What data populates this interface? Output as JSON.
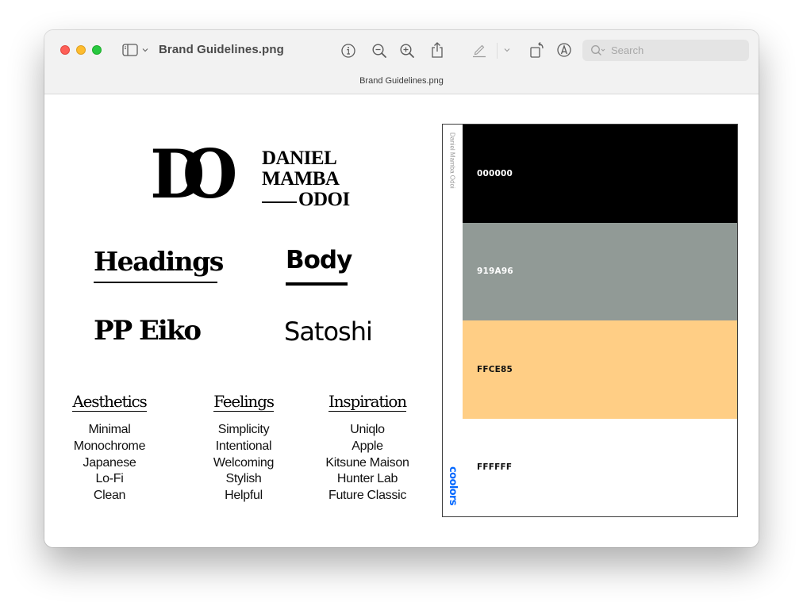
{
  "window": {
    "title": "Brand Guidelines.png",
    "tab_title": "Brand Guidelines.png"
  },
  "toolbar": {
    "sidebar_toggle_icon": "sidebar-icon",
    "chevron_icon": "chevron-down-icon",
    "info_icon": "info-icon",
    "zoom_out_icon": "zoom-out-icon",
    "zoom_in_icon": "zoom-in-icon",
    "share_icon": "share-icon",
    "markup_pen_icon": "pencil-icon",
    "rotate_icon": "rotate-icon",
    "annotate_icon": "markup-icon",
    "search": {
      "placeholder": "Search",
      "value": ""
    }
  },
  "document": {
    "logo": {
      "monogram": "DO",
      "line1": "DANIEL",
      "line2": "MAMBA",
      "line3": "ODOI"
    },
    "fonts": {
      "headings_label": "Headings",
      "body_label": "Body",
      "headings_font": "PP Eiko",
      "body_font": "Satoshi"
    },
    "columns": [
      {
        "title": "Aesthetics",
        "items": [
          "Minimal",
          "Monochrome",
          "Japanese",
          "Lo-Fi",
          "Clean"
        ]
      },
      {
        "title": "Feelings",
        "items": [
          "Simplicity",
          "Intentional",
          "Welcoming",
          "Stylish",
          "Helpful"
        ]
      },
      {
        "title": "Inspiration",
        "items": [
          "Uniqlo",
          "Apple",
          "Kitsune Maison",
          "Hunter Lab",
          "Future Classic"
        ]
      }
    ],
    "palette": {
      "author": "Daniel Mamba Odoi",
      "brand": "coolors",
      "brand_color": "#0066ff",
      "swatches": [
        {
          "hex": "000000",
          "color": "#000000",
          "text_color": "#ffffff"
        },
        {
          "hex": "919A96",
          "color": "#919A96",
          "text_color": "#ffffff"
        },
        {
          "hex": "FFCE85",
          "color": "#FFCE85",
          "text_color": "#111111"
        },
        {
          "hex": "FFFFFF",
          "color": "#FFFFFF",
          "text_color": "#111111"
        }
      ]
    }
  }
}
